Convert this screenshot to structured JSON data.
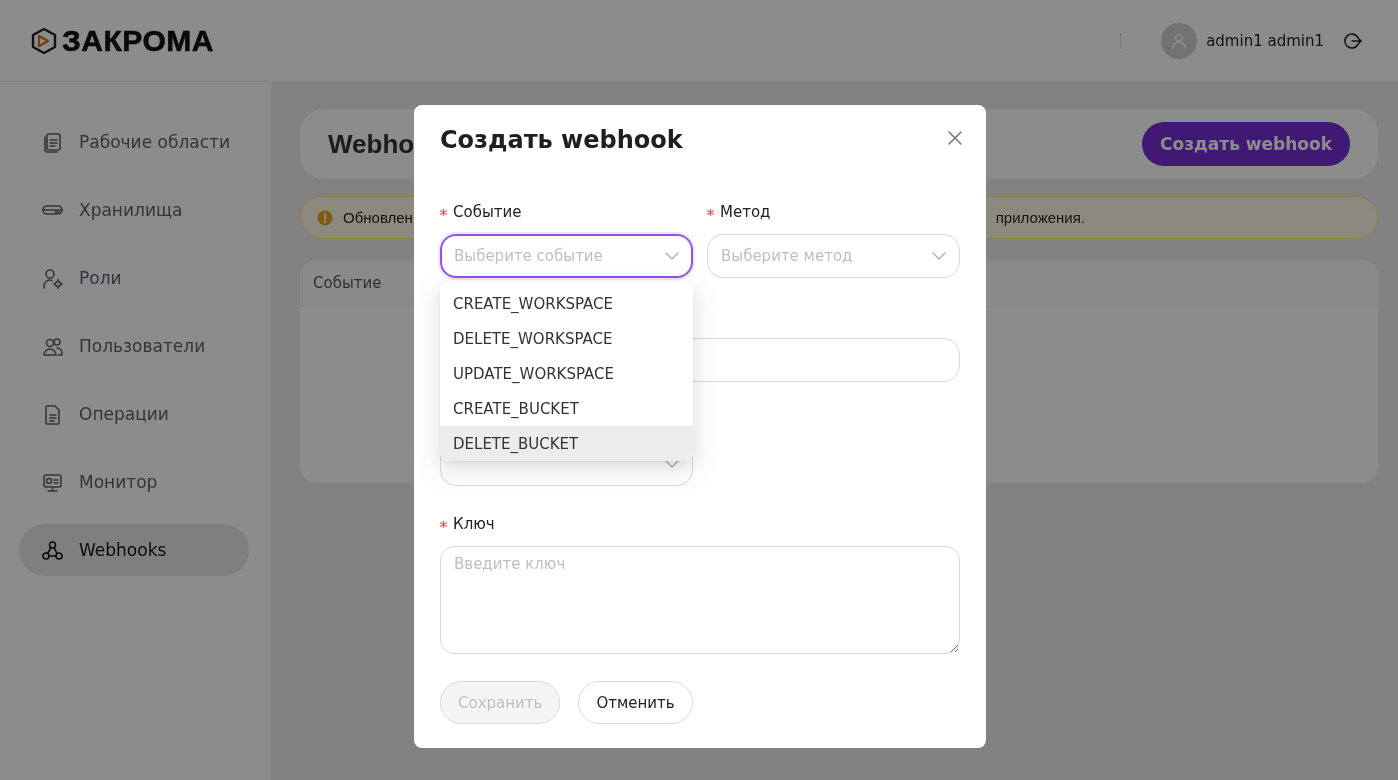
{
  "header": {
    "logo": "ЗАКРОМА",
    "user": {
      "name": "admin1 admin1"
    }
  },
  "sidebar": {
    "items": [
      {
        "label": "Рабочие области",
        "kind": "files",
        "selected": false
      },
      {
        "label": "Хранилища",
        "kind": "storage",
        "selected": false
      },
      {
        "label": "Роли",
        "kind": "roles",
        "selected": false
      },
      {
        "label": "Пользователи",
        "kind": "users",
        "selected": false
      },
      {
        "label": "Операции",
        "kind": "document",
        "selected": false
      },
      {
        "label": "Монитор",
        "kind": "monitor",
        "selected": false
      },
      {
        "label": "Webhooks",
        "kind": "webhook",
        "selected": true
      }
    ]
  },
  "page": {
    "title": "Webho",
    "create_button": "Создать webhook",
    "alert": {
      "texts": [
        "Обновлен",
        "приложения."
      ]
    },
    "table": {
      "columns": [
        "Событие"
      ]
    }
  },
  "modal": {
    "title": "Создать webhook",
    "fields": [
      {
        "kind": "select",
        "label": "Событие",
        "required": true,
        "placeholder": "Выберите событие",
        "focused": true,
        "open": true,
        "options": [
          {
            "label": "CREATE_WORKSPACE",
            "highlighted": false
          },
          {
            "label": "DELETE_WORKSPACE",
            "highlighted": false
          },
          {
            "label": "UPDATE_WORKSPACE",
            "highlighted": false
          },
          {
            "label": "CREATE_BUCKET",
            "highlighted": false
          },
          {
            "label": "DELETE_BUCKET",
            "highlighted": true
          }
        ]
      },
      {
        "kind": "select",
        "label": "Метод",
        "required": true,
        "placeholder": "Выберите метод",
        "focused": false
      },
      {
        "kind": "input"
      },
      {
        "kind": "select",
        "focused": false
      },
      {
        "kind": "textarea",
        "label": "Ключ",
        "required": true,
        "placeholder": "Введите ключ"
      }
    ],
    "buttons": [
      {
        "label": "Сохранить",
        "kind": "primary",
        "disabled": true
      },
      {
        "label": "Отменить",
        "kind": "default",
        "disabled": false
      }
    ]
  }
}
